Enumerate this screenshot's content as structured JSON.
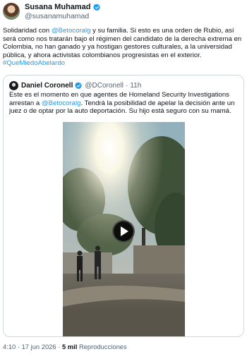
{
  "author": {
    "display_name": "Susana Muhamad",
    "handle": "@susanamuhamad",
    "verified_icon": "verified-badge-icon",
    "verified_color": "#1d9bf0"
  },
  "post": {
    "text_parts": [
      "Solidaridad con ",
      "@Betocoralg",
      " y su familia. Si esto es una orden de Rubio, así será como nos tratarán bajo el régimen del candidato de la derecha extrema en Colombia, no han ganado y ya hostigan gestores culturales, a la universidad pública, y ahora activistas colombianos progresistas en el exterior.",
      "#QueMiedoAbelardo"
    ],
    "link_color": "#1d9bf0"
  },
  "quote": {
    "display_name": "Daniel Coronell",
    "handle": "@DCoronell",
    "separator": "·",
    "time": "11h",
    "text_parts": [
      "Este es el momento en que agentes de Homeland Security Investigations arrestan a ",
      "@Betocoralg",
      ". Tendrá la posibilidad de apelar la decisión ante un juez o de optar por la auto deportación. Su hijo está seguro con su mamá."
    ],
    "media": {
      "type": "video",
      "play_icon": "play-icon"
    }
  },
  "footer": {
    "time": "4:10",
    "date": "17 jun 2026",
    "views_count": "5 mil",
    "views_label": "Reproducciones",
    "separator": "·"
  }
}
